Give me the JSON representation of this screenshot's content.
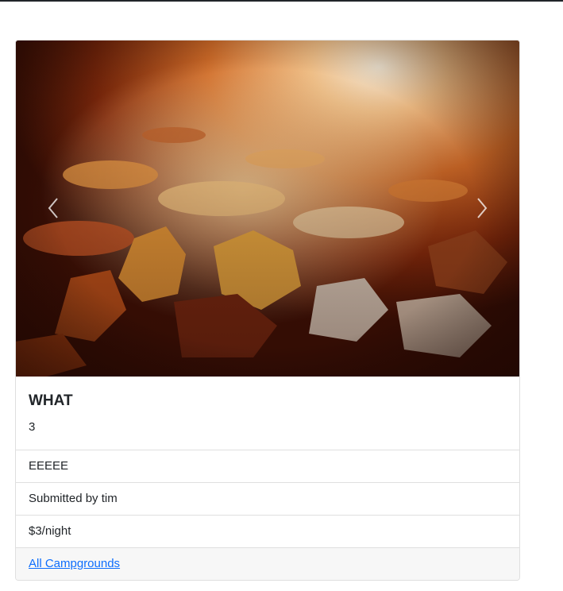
{
  "campground": {
    "title": "WHAT",
    "description": "3",
    "location": "EEEEE",
    "submitted_by": "Submitted by tim",
    "price": "$3/night"
  },
  "footer": {
    "link_label": "All Campgrounds"
  },
  "carousel": {
    "image_subject": "autumn leaves on the ground",
    "prev_icon": "chevron-left-icon",
    "next_icon": "chevron-right-icon"
  },
  "colors": {
    "link": "#0d6efd",
    "border": "#dfdfdf",
    "footer_bg": "#f7f7f7",
    "text": "#212529"
  }
}
